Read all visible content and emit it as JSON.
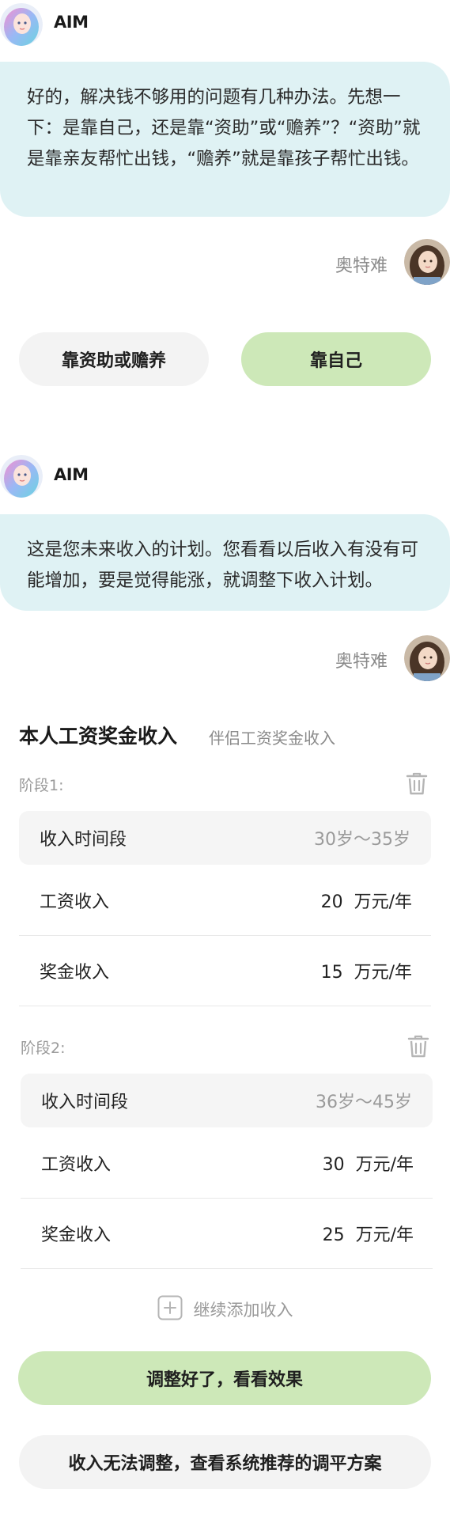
{
  "colors": {
    "bubble_bg": "#dff2f4",
    "accent_green": "#cde8b8",
    "grey_pill": "#f3f3f3"
  },
  "ai": {
    "name": "AIM"
  },
  "user": {
    "name": "奥特难"
  },
  "messages": [
    {
      "sender": "ai",
      "text": "好的，解决钱不够用的问题有几种办法。先想一下：是靠自己，还是靠“资助”或“赡养”？“资助”就是靠亲友帮忙出钱，“赡养”就是靠孩子帮忙出钱。"
    },
    {
      "sender": "ai",
      "text": "这是您未来收入的计划。您看看以后收入有没有可能增加，要是觉得能涨，就调整下收入计划。"
    }
  ],
  "choices": {
    "option_support": "靠资助或赡养",
    "option_self": "靠自己"
  },
  "tabs": {
    "active": "本人工资奖金收入",
    "inactive": "伴侣工资奖金收入"
  },
  "income_plan": {
    "period_label": "收入时间段",
    "salary_label": "工资收入",
    "bonus_label": "奖金收入",
    "unit": "万元/年",
    "stages": [
      {
        "label": "阶段1:",
        "period": "30岁～35岁",
        "salary": "20",
        "bonus": "15"
      },
      {
        "label": "阶段2:",
        "period": "36岁～45岁",
        "salary": "30",
        "bonus": "25"
      }
    ],
    "add_label": "继续添加收入"
  },
  "actions": {
    "confirm": "调整好了，看看效果",
    "recommend": "收入无法调整，查看系统推荐的调平方案"
  }
}
